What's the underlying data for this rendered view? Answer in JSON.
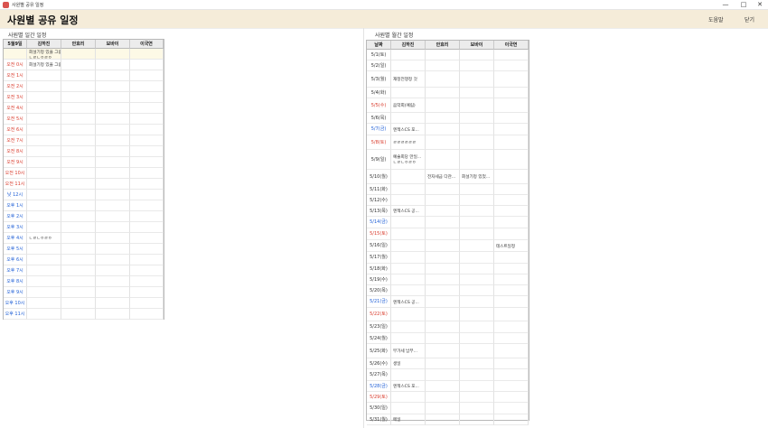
{
  "window": {
    "title": "사원별 공유 일정",
    "controls": [
      "—",
      "□",
      "✕"
    ]
  },
  "header": {
    "title": "사원별 공유 일정",
    "help": "도움말",
    "close": "닫기"
  },
  "daily": {
    "section_title": "사원별 일간 일정",
    "columns": [
      "5월9일",
      "김하진",
      "안효리",
      "보바이",
      "이국연"
    ],
    "rows": [
      {
        "label": "",
        "color": "black",
        "highlight": true
      },
      {
        "label": "오전 0시",
        "color": "red"
      },
      {
        "label": "오전 1시",
        "color": "red"
      },
      {
        "label": "오전 2시",
        "color": "red"
      },
      {
        "label": "오전 3시",
        "color": "red"
      },
      {
        "label": "오전 4시",
        "color": "red"
      },
      {
        "label": "오전 5시",
        "color": "red"
      },
      {
        "label": "오전 6시",
        "color": "red"
      },
      {
        "label": "오전 7시",
        "color": "red"
      },
      {
        "label": "오전 8시",
        "color": "red"
      },
      {
        "label": "오전 9시",
        "color": "red"
      },
      {
        "label": "오전 10시",
        "color": "red"
      },
      {
        "label": "오전 11시",
        "color": "red"
      },
      {
        "label": "낮 12시",
        "color": "blue"
      },
      {
        "label": "오후 1시",
        "color": "blue"
      },
      {
        "label": "오후 2시",
        "color": "blue"
      },
      {
        "label": "오후 3시",
        "color": "blue"
      },
      {
        "label": "오후 4시",
        "color": "blue"
      },
      {
        "label": "오후 5시",
        "color": "blue"
      },
      {
        "label": "오후 6시",
        "color": "blue"
      },
      {
        "label": "오후 7시",
        "color": "blue"
      },
      {
        "label": "오후 8시",
        "color": "blue"
      },
      {
        "label": "오후 9시",
        "color": "blue"
      },
      {
        "label": "오후 10시",
        "color": "blue"
      },
      {
        "label": "오후 11시",
        "color": "blue"
      }
    ],
    "entries": [
      {
        "row": 0,
        "col": 1,
        "lines": [
          "회설기정 있을 그림",
          "ㄴㄹㄴㅇㄹㅇ"
        ]
      },
      {
        "row": 1,
        "col": 1,
        "lines": [
          "회설기정 있을 그림"
        ]
      },
      {
        "row": 17,
        "col": 1,
        "lines": [
          "ㄴㄹㄴㅇㄹㅇ"
        ]
      }
    ]
  },
  "monthly": {
    "section_title": "사원별 월간 일정",
    "columns": [
      "날짜",
      "김하진",
      "안효리",
      "보바이",
      "이국연"
    ],
    "rows": [
      {
        "label": "5/1(토)",
        "color": "black"
      },
      {
        "label": "5/2(일)",
        "color": "black"
      },
      {
        "label": "5/3(월)",
        "color": "black"
      },
      {
        "label": "5/4(화)",
        "color": "black"
      },
      {
        "label": "5/5(수)",
        "color": "red"
      },
      {
        "label": "5/6(목)",
        "color": "black"
      },
      {
        "label": "5/7(금)",
        "color": "blue"
      },
      {
        "label": "5/8(토)",
        "color": "red"
      },
      {
        "label": "5/9(일)",
        "color": "black"
      },
      {
        "label": "5/10(월)",
        "color": "black"
      },
      {
        "label": "5/11(화)",
        "color": "black"
      },
      {
        "label": "5/12(수)",
        "color": "black"
      },
      {
        "label": "5/13(목)",
        "color": "black"
      },
      {
        "label": "5/14(금)",
        "color": "blue"
      },
      {
        "label": "5/15(토)",
        "color": "red"
      },
      {
        "label": "5/16(일)",
        "color": "black"
      },
      {
        "label": "5/17(월)",
        "color": "black"
      },
      {
        "label": "5/18(화)",
        "color": "black"
      },
      {
        "label": "5/19(수)",
        "color": "black"
      },
      {
        "label": "5/20(목)",
        "color": "black"
      },
      {
        "label": "5/21(금)",
        "color": "blue"
      },
      {
        "label": "5/22(토)",
        "color": "red"
      },
      {
        "label": "5/23(일)",
        "color": "black"
      },
      {
        "label": "5/24(월)",
        "color": "black"
      },
      {
        "label": "5/25(화)",
        "color": "black"
      },
      {
        "label": "5/26(수)",
        "color": "black"
      },
      {
        "label": "5/27(목)",
        "color": "black"
      },
      {
        "label": "5/28(금)",
        "color": "blue"
      },
      {
        "label": "5/29(토)",
        "color": "red"
      },
      {
        "label": "5/30(일)",
        "color": "black"
      },
      {
        "label": "5/31(월)",
        "color": "black"
      }
    ],
    "entries": [
      {
        "row": 2,
        "col": 1,
        "lines": [
          "재정전쟁정 것"
        ]
      },
      {
        "row": 4,
        "col": 1,
        "lines": [
          "음악회(예림)"
        ]
      },
      {
        "row": 6,
        "col": 1,
        "lines": [
          "엔젝스CS 포..."
        ]
      },
      {
        "row": 7,
        "col": 1,
        "lines": [
          "ㄹㄹㄹㄹㄹㄹ"
        ]
      },
      {
        "row": 8,
        "col": 1,
        "lines": [
          "예술회당 만일...",
          "ㄴㄹㄴㅇㄹㅇ"
        ]
      },
      {
        "row": 9,
        "col": 2,
        "lines": [
          "전자세금 다관..."
        ]
      },
      {
        "row": 9,
        "col": 3,
        "lines": [
          "회설기정 있었..."
        ]
      },
      {
        "row": 12,
        "col": 1,
        "lines": [
          "엔젝스CS 공..."
        ]
      },
      {
        "row": 15,
        "col": 4,
        "lines": [
          "테스트일정"
        ]
      },
      {
        "row": 20,
        "col": 1,
        "lines": [
          "엔젝스CS 공..."
        ]
      },
      {
        "row": 24,
        "col": 1,
        "lines": [
          "부가세 납부..."
        ]
      },
      {
        "row": 25,
        "col": 1,
        "lines": [
          "생일"
        ]
      },
      {
        "row": 27,
        "col": 1,
        "lines": [
          "엔젝스CS 포..."
        ]
      },
      {
        "row": 30,
        "col": 1,
        "lines": [
          "메일"
        ]
      }
    ]
  },
  "colors": {
    "header_bg": "#f5ecd9",
    "weekend_red": "#d93a2b",
    "weekday_blue": "#1f5fd6"
  }
}
